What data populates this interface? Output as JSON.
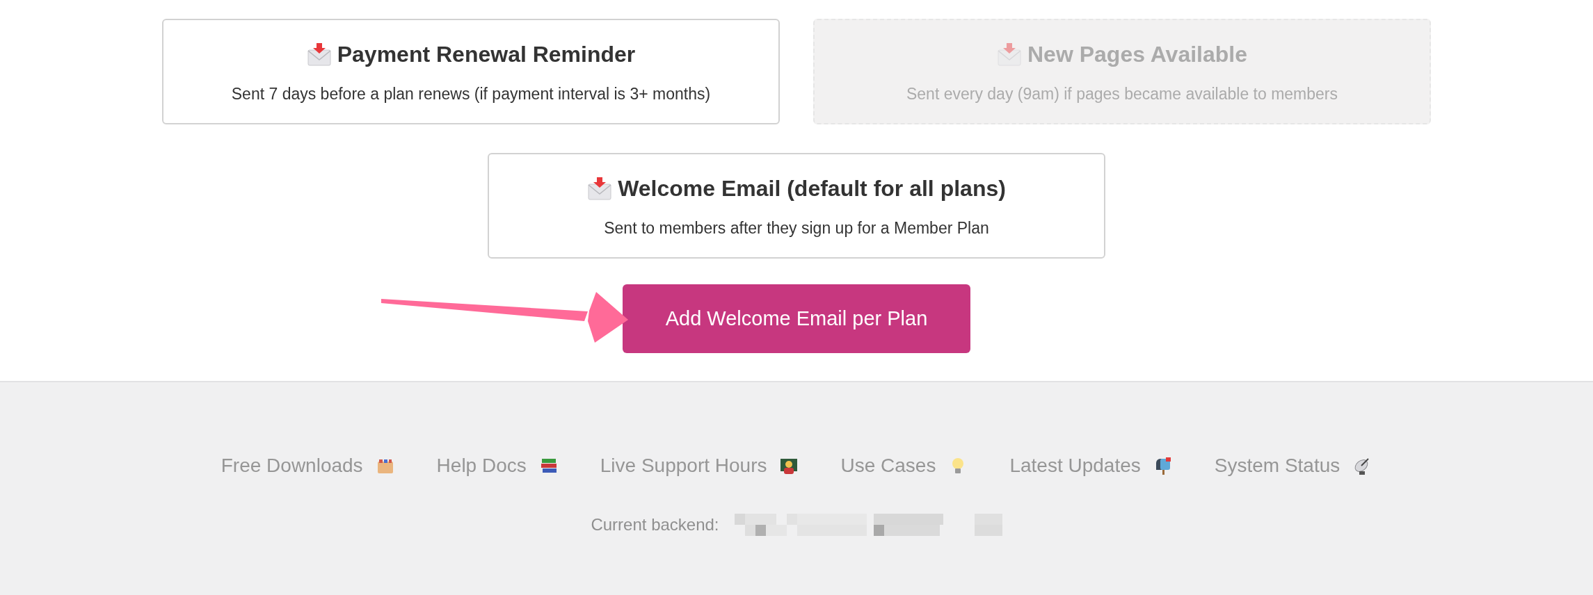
{
  "email_cards": [
    {
      "title": "Payment Renewal Reminder",
      "description": "Sent 7 days before a plan renews (if payment interval is 3+ months)",
      "disabled": false
    },
    {
      "title": "New Pages Available",
      "description": "Sent every day (9am) if pages became available to members",
      "disabled": true
    },
    {
      "title": "Welcome Email (default for all plans)",
      "description": "Sent to members after they sign up for a Member Plan",
      "disabled": false
    }
  ],
  "add_button": {
    "label": "Add Welcome Email per Plan"
  },
  "footer": {
    "links": [
      "Free Downloads",
      "Help Docs",
      "Live Support Hours",
      "Use Cases",
      "Latest Updates",
      "System Status"
    ],
    "backend_label": "Current backend:"
  }
}
